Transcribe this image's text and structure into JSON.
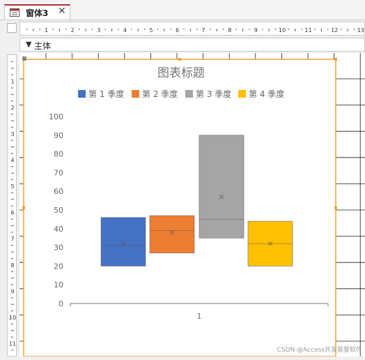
{
  "window": {
    "tab_label": "窗体3",
    "close_glyph": "✕"
  },
  "section": {
    "arrow": "▼",
    "label": "主体"
  },
  "ruler": {
    "top_labels": [
      "1",
      "2",
      "3",
      "4",
      "5",
      "6",
      "7",
      "8",
      "9",
      "10",
      "11",
      "12",
      "13"
    ],
    "left_labels": [
      "1",
      "2",
      "3",
      "4",
      "5",
      "6",
      "7",
      "8",
      "9",
      "10",
      "11"
    ]
  },
  "chart_data": {
    "type": "box",
    "title": "图表标题",
    "categories": [
      "1"
    ],
    "ylim": [
      0,
      100
    ],
    "yticks": [
      0,
      10,
      20,
      30,
      40,
      50,
      60,
      70,
      80,
      90,
      100
    ],
    "grid": false,
    "legend_position": "top",
    "series": [
      {
        "name": "第 1 季度",
        "color": "#4472c4",
        "q1": 20,
        "median": 31,
        "q3": 46,
        "mean": 32
      },
      {
        "name": "第 2 季度",
        "color": "#ed7d31",
        "q1": 27,
        "median": 39,
        "q3": 47,
        "mean": 38
      },
      {
        "name": "第 3 季度",
        "color": "#a5a5a5",
        "q1": 35,
        "median": 45,
        "q3": 90,
        "mean": 57
      },
      {
        "name": "第 4 季度",
        "color": "#ffc000",
        "q1": 20,
        "median": 32,
        "q3": 44,
        "mean": 32
      }
    ]
  },
  "watermark": "CSDN @Access开发易登软件"
}
